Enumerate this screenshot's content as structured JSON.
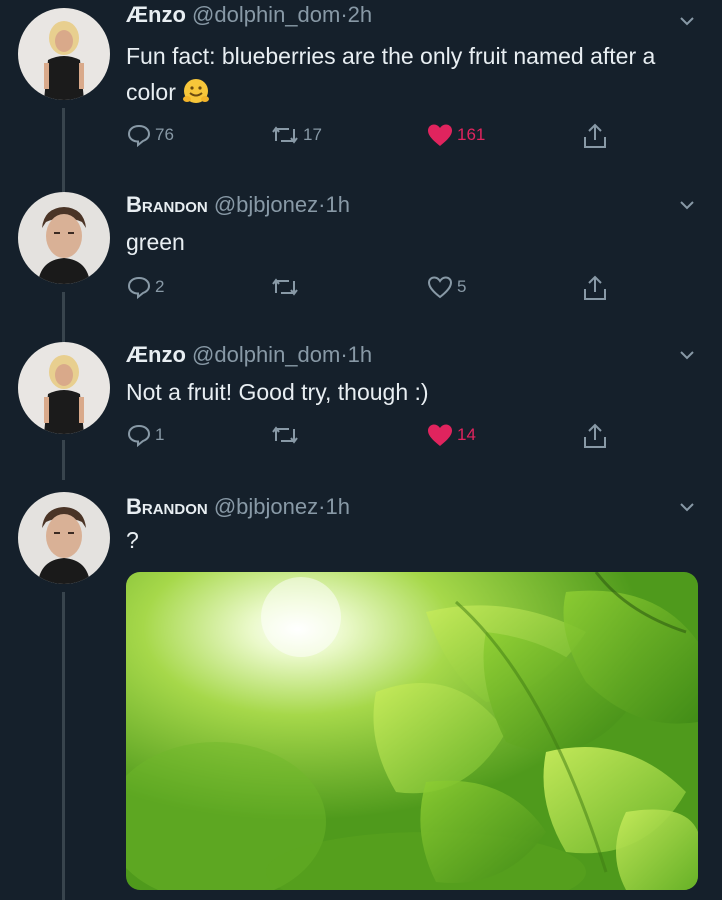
{
  "tweets": [
    {
      "name": "Ænzo",
      "handle": "@dolphin_dom",
      "dot": "·",
      "time": "2h",
      "text": "Fun fact: blueberries are the only fruit named after a color",
      "emoji": "hugging-face-emoji",
      "replies": "76",
      "retweets": "17",
      "likes": "161",
      "liked": true
    },
    {
      "name": "Brandon",
      "handle": "@bjbjonez",
      "dot": "·",
      "time": "1h",
      "text": "green",
      "replies": "2",
      "retweets": "",
      "likes": "5",
      "liked": false
    },
    {
      "name": "Ænzo",
      "handle": "@dolphin_dom",
      "dot": "·",
      "time": "1h",
      "text": "Not a fruit! Good try, though :)",
      "replies": "1",
      "retweets": "",
      "likes": "14",
      "liked": true
    },
    {
      "name": "Brandon",
      "handle": "@bjbjonez",
      "dot": "·",
      "time": "1h",
      "text": "?",
      "media": "green-leaves-sunlight-photo"
    }
  ],
  "colors": {
    "background": "#15202b",
    "liked": "#e0245e",
    "muted": "#8899a6"
  }
}
